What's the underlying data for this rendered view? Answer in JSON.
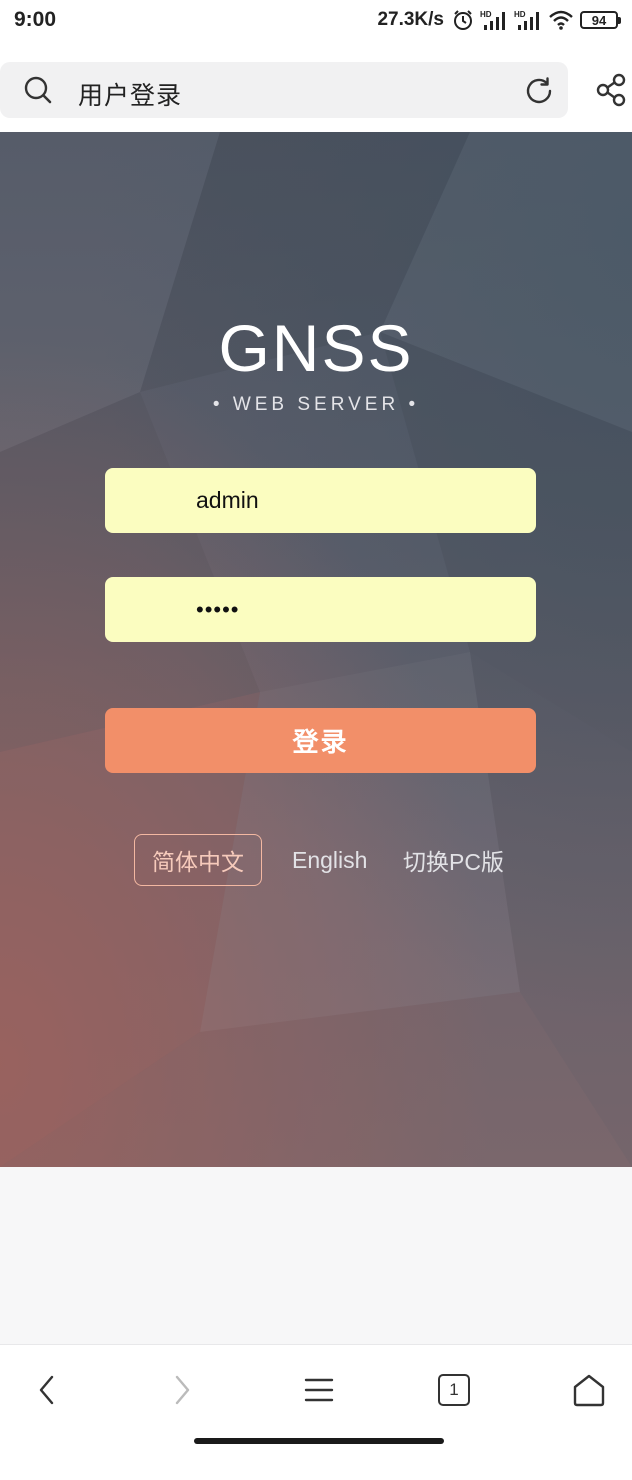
{
  "status_bar": {
    "time": "9:00",
    "net_speed": "27.3K/s",
    "battery": "94",
    "icons": [
      "alarm-icon",
      "signal-hd-icon",
      "signal-hd-icon",
      "wifi-icon",
      "battery-icon"
    ]
  },
  "top_bar": {
    "page_title": "用户登录",
    "icons": [
      "search-icon",
      "refresh-icon",
      "share-icon"
    ]
  },
  "login": {
    "brand_title": "GNSS",
    "brand_subtitle": "• WEB SERVER •",
    "username_value": "admin",
    "password_value": "•••••",
    "login_label": "登录"
  },
  "languages": {
    "items": [
      "简体中文",
      "English",
      "切换PC版"
    ],
    "active": "简体中文"
  },
  "bottom_nav": {
    "tab_count": "1",
    "icons": [
      "back-icon",
      "forward-icon",
      "menu-icon",
      "tabs-icon",
      "home-icon"
    ]
  },
  "colors": {
    "input_bg": "#fbfdc0",
    "login_button": "#f28f69",
    "active_lang_border": "#f3b8a2"
  }
}
